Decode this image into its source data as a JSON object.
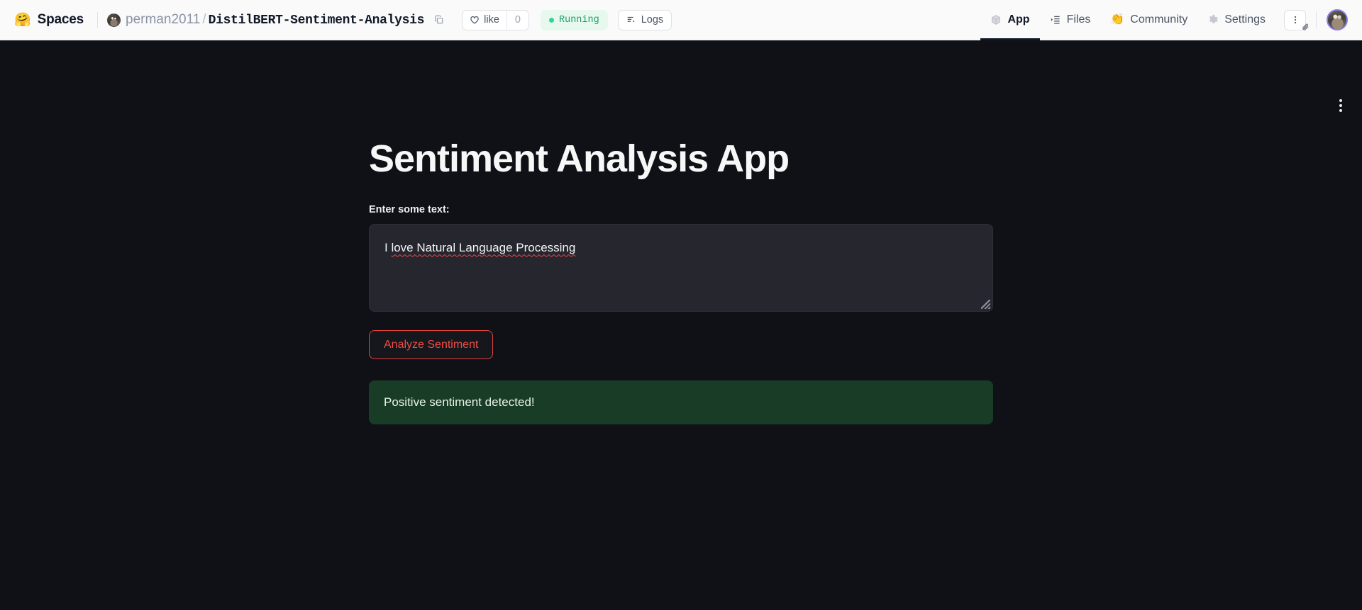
{
  "header": {
    "brand": {
      "emoji": "🤗",
      "label": "Spaces"
    },
    "repo": {
      "owner": "perman2011",
      "separator": "/",
      "name": "DistilBERT-Sentiment-Analysis",
      "copy_icon": "copy-icon"
    },
    "like": {
      "icon": "heart-icon",
      "label": "like",
      "count": "0"
    },
    "status": {
      "label": "Running",
      "dot_color": "#34d399",
      "bg_color": "#e7f9ef",
      "text_color": "#1f9d62"
    },
    "logs": {
      "icon": "logs-icon",
      "label": "Logs"
    },
    "nav": [
      {
        "icon": "cube-icon",
        "label": "App",
        "active": true
      },
      {
        "icon": "files-icon",
        "label": "Files",
        "active": false
      },
      {
        "icon": "clapping-hands-icon",
        "label": "Community",
        "active": false
      },
      {
        "icon": "gear-icon",
        "label": "Settings",
        "active": false
      }
    ],
    "kebab": {
      "icon": "kebab-menu-icon",
      "overlay_icon": "paperclip-icon"
    },
    "avatar": {
      "icon": "user-avatar",
      "ring_color": "#8b7fe8"
    }
  },
  "app": {
    "kebab_icon": "app-kebab-menu-icon",
    "title": "Sentiment Analysis App",
    "input": {
      "label": "Enter some text:",
      "value": "I love Natural Language Processing",
      "placeholder": "",
      "spellcheck_underline_color": "#e64a4a"
    },
    "analyze_button": {
      "label": "Analyze Sentiment",
      "border_color": "#e0423b",
      "text_color": "#ef4b44"
    },
    "result": {
      "text": "Positive sentiment detected!",
      "bg_color": "#193c26",
      "text_color": "#e6f5e8"
    },
    "background_color": "#0f1117"
  }
}
